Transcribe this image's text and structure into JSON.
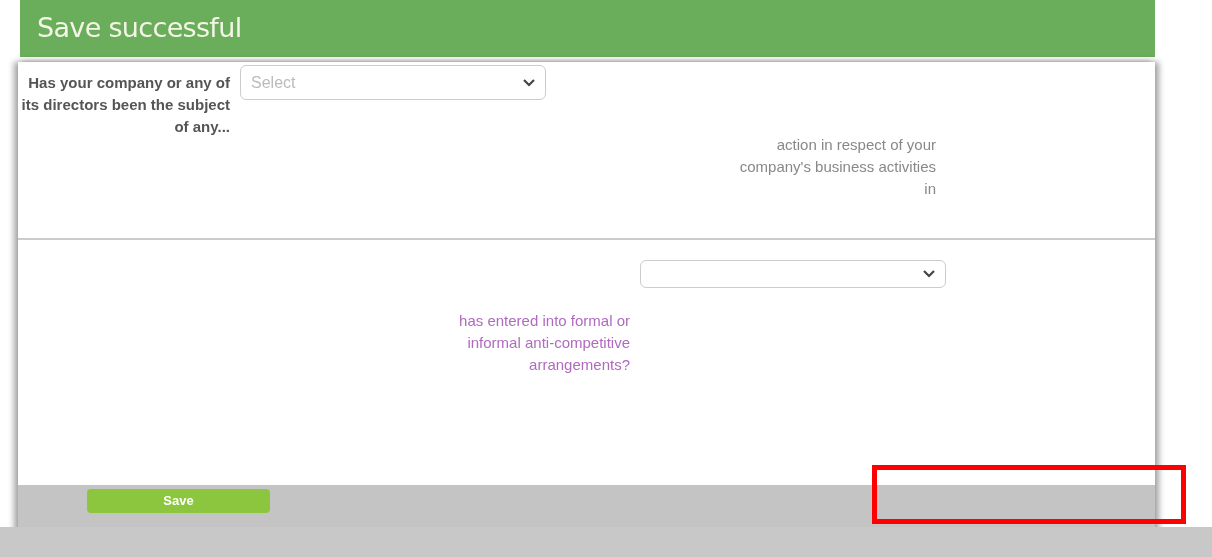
{
  "banner": {
    "title": "Save successful"
  },
  "questions": [
    {
      "label": "Has your company or any of its directors been the subject of any...",
      "placeholder": "Select"
    },
    {
      "label": "action in respect of your company's business activities in"
    },
    {
      "label": "has entered into formal or informal anti-competitive arrangements?"
    }
  ],
  "footer": {
    "button": "Save"
  }
}
